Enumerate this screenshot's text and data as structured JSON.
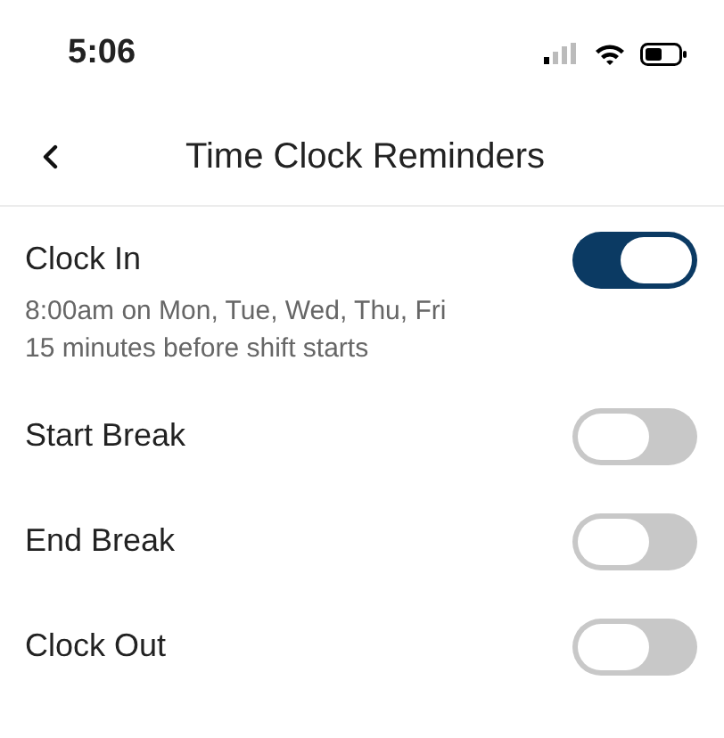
{
  "status_bar": {
    "time": "5:06"
  },
  "nav": {
    "title": "Time Clock Reminders"
  },
  "reminders": [
    {
      "label": "Clock In",
      "on": true,
      "details": [
        "8:00am on Mon, Tue, Wed, Thu, Fri",
        "15 minutes before shift starts"
      ]
    },
    {
      "label": "Start Break",
      "on": false
    },
    {
      "label": "End Break",
      "on": false
    },
    {
      "label": "Clock Out",
      "on": false
    }
  ]
}
